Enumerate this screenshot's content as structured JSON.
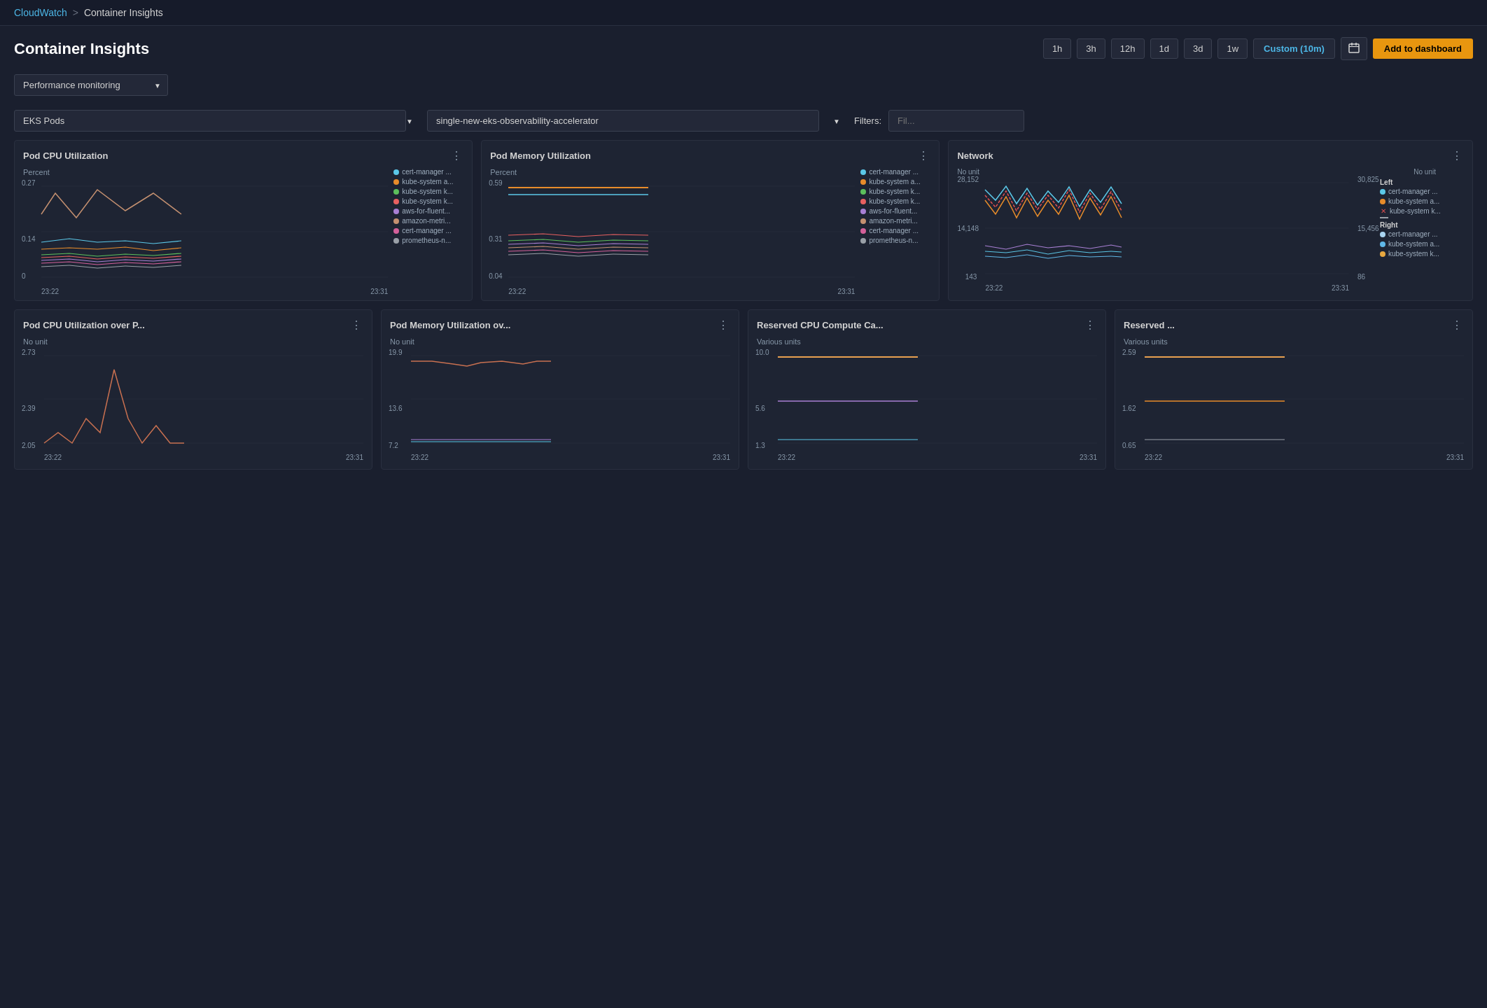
{
  "nav": {
    "cloudwatch_label": "CloudWatch",
    "sep": ">",
    "current_page": "Container Insights"
  },
  "header": {
    "title": "Container Insights",
    "time_buttons": [
      "1h",
      "3h",
      "12h",
      "1d",
      "3d",
      "1w"
    ],
    "custom_label": "Custom (10m)",
    "add_dashboard_label": "Add to dashboard"
  },
  "performance_dropdown": {
    "label": "Performance monitoring",
    "placeholder": "Performance monitoring"
  },
  "filter_row": {
    "resource_type": "EKS Pods",
    "cluster": "single-new-eks-observability-accelerator",
    "filters_label": "Filters:",
    "filter_placeholder": "Fil..."
  },
  "charts": {
    "row1": [
      {
        "id": "pod-cpu",
        "title": "Pod CPU Utilization",
        "y_label": "Percent",
        "y_values": [
          "0.27",
          "0.14",
          "0"
        ],
        "x_values": [
          "23:22",
          "23:31"
        ],
        "legend": [
          {
            "color": "#5bc8e8",
            "label": "cert-manager ..."
          },
          {
            "color": "#e88c2a",
            "label": "kube-system a..."
          },
          {
            "color": "#5cbf5c",
            "label": "kube-system k..."
          },
          {
            "color": "#e86060",
            "label": "kube-system k..."
          },
          {
            "color": "#a87fd4",
            "label": "aws-for-fluent..."
          },
          {
            "color": "#c49070",
            "label": "amazon-metri..."
          },
          {
            "color": "#d4609a",
            "label": "cert-manager ..."
          },
          {
            "color": "#9aa0a8",
            "label": "prometheus-n..."
          }
        ]
      },
      {
        "id": "pod-memory",
        "title": "Pod Memory Utilization",
        "y_label": "Percent",
        "y_values": [
          "0.59",
          "0.31",
          "0.04"
        ],
        "x_values": [
          "23:22",
          "23:31"
        ],
        "legend": [
          {
            "color": "#5bc8e8",
            "label": "cert-manager ..."
          },
          {
            "color": "#e88c2a",
            "label": "kube-system a..."
          },
          {
            "color": "#5cbf5c",
            "label": "kube-system k..."
          },
          {
            "color": "#e86060",
            "label": "kube-system k..."
          },
          {
            "color": "#a87fd4",
            "label": "aws-for-fluent..."
          },
          {
            "color": "#c49070",
            "label": "amazon-metri..."
          },
          {
            "color": "#d4609a",
            "label": "cert-manager ..."
          },
          {
            "color": "#9aa0a8",
            "label": "prometheus-n..."
          }
        ]
      },
      {
        "id": "network",
        "title": "Network",
        "y_label_left": "No unit",
        "y_label_right": "No unit",
        "y_left": [
          "28,152",
          "14,148",
          "143"
        ],
        "y_right": [
          "30,825",
          "15,456",
          "86"
        ],
        "x_values": [
          "23:22",
          "23:31"
        ],
        "legend_left_title": "Left",
        "legend_right_title": "Right",
        "legend": [
          {
            "color": "#5bc8e8",
            "label": "cert-manager ...",
            "side": "left",
            "type": "dot"
          },
          {
            "color": "#e88c2a",
            "label": "kube-system a...",
            "side": "left",
            "type": "dot"
          },
          {
            "color": "#e05050",
            "label": "kube-system k...",
            "side": "left",
            "type": "x"
          },
          {
            "color": "#9aa0a8",
            "label": "",
            "side": "left",
            "type": "line"
          },
          {
            "color": "#aad4f0",
            "label": "cert-manager ...",
            "side": "right",
            "type": "dot"
          },
          {
            "color": "#60b8e8",
            "label": "kube-system a...",
            "side": "right",
            "type": "dot"
          },
          {
            "color": "#e8a840",
            "label": "kube-system k...",
            "side": "right",
            "type": "dot"
          }
        ]
      }
    ],
    "row2": [
      {
        "id": "pod-cpu-over-p",
        "title": "Pod CPU Utilization over P...",
        "y_label": "No unit",
        "y_values": [
          "2.73",
          "2.39",
          "2.05"
        ],
        "x_values": [
          "23:22",
          "23:31"
        ]
      },
      {
        "id": "pod-memory-over",
        "title": "Pod Memory Utilization ov...",
        "y_label": "No unit",
        "y_values": [
          "19.9",
          "13.6",
          "7.2"
        ],
        "x_values": [
          "23:22",
          "23:31"
        ]
      },
      {
        "id": "reserved-cpu",
        "title": "Reserved CPU Compute Ca...",
        "y_label": "Various units",
        "y_values": [
          "10.0",
          "5.6",
          "1.3"
        ],
        "x_values": [
          "23:22",
          "23:31"
        ]
      },
      {
        "id": "reserved-mem",
        "title": "Reserved ...",
        "y_label": "Various units",
        "y_values": [
          "2.59",
          "1.62",
          "0.65"
        ],
        "x_values": [
          "23:22",
          "23:31"
        ]
      }
    ]
  }
}
